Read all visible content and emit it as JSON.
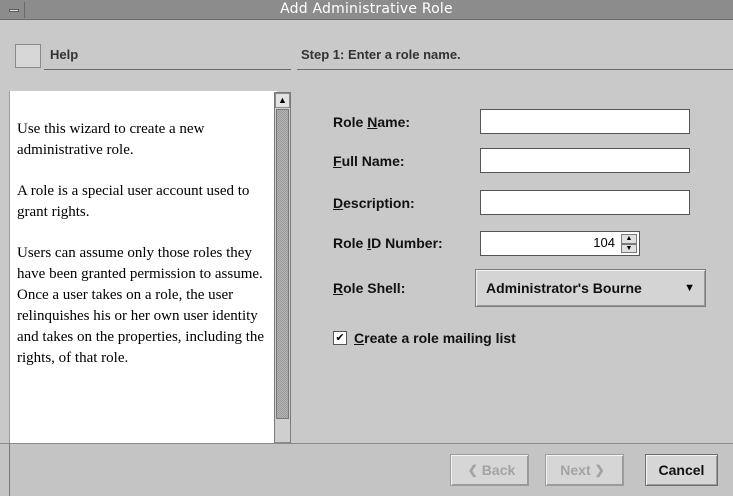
{
  "window": {
    "title": "Add Administrative Role"
  },
  "help": {
    "title": "Help",
    "paragraphs": [
      "Use this wizard to create a new administrative role.",
      "A role is a special user account used to grant rights.",
      "Users can assume only those roles they have been granted permission to assume. Once a user takes on a role, the user relinquishes his or her own user identity and takes on the properties, including the rights, of that role."
    ]
  },
  "step": {
    "title": "Step 1: Enter a role name."
  },
  "form": {
    "role_name": {
      "label_pre": "Role ",
      "label_key": "N",
      "label_post": "ame:",
      "value": ""
    },
    "full_name": {
      "label_pre": "",
      "label_key": "F",
      "label_post": "ull Name:",
      "value": ""
    },
    "description": {
      "label_pre": "",
      "label_key": "D",
      "label_post": "escription:",
      "value": ""
    },
    "role_id": {
      "label_pre": "Role ",
      "label_key": "I",
      "label_post": "D Number:",
      "value": "104"
    },
    "role_shell": {
      "label_pre": "",
      "label_key": "R",
      "label_post": "ole Shell:",
      "value": "Administrator's Bourne"
    },
    "mailing_list": {
      "label_key": "C",
      "label_post": "reate a role mailing list",
      "checked": true
    }
  },
  "buttons": {
    "back": "Back",
    "next": "Next",
    "cancel": "Cancel"
  }
}
